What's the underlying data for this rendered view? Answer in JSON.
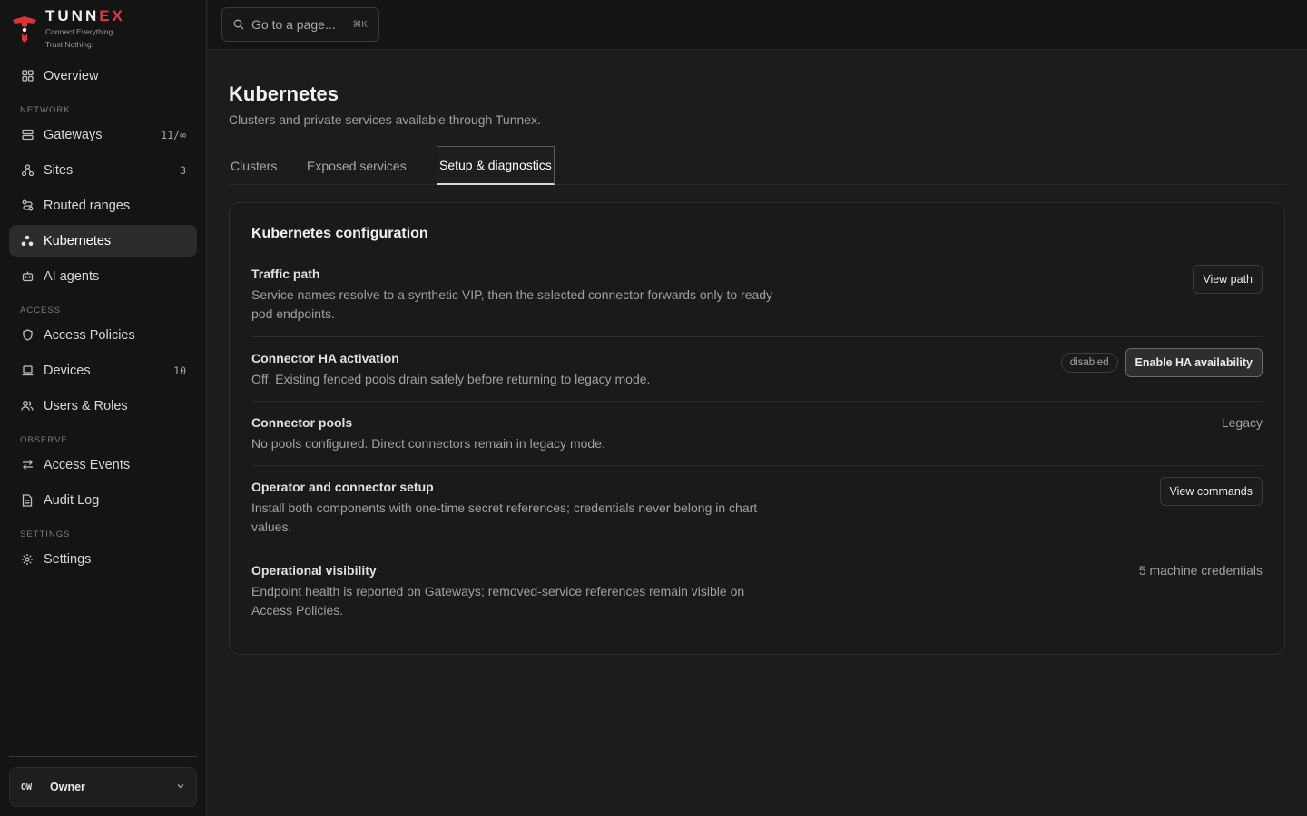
{
  "brand": {
    "wordmark_main": "TUNN",
    "wordmark_accent": "EX",
    "tagline_line1": "Connect Everything.",
    "tagline_line2": "Trust Nothing.",
    "accent_color": "#e0393e"
  },
  "sidebar": {
    "overview": {
      "label": "Overview",
      "icon": "grid-icon"
    },
    "sections": {
      "network": "NETWORK",
      "access": "ACCESS",
      "observe": "OBSERVE",
      "settings": "SETTINGS"
    },
    "items": {
      "gateways": {
        "label": "Gateways",
        "count": "11/∞",
        "icon": "server-icon"
      },
      "sites": {
        "label": "Sites",
        "count": "3",
        "icon": "sites-icon"
      },
      "routed_ranges": {
        "label": "Routed ranges",
        "icon": "route-icon"
      },
      "kubernetes": {
        "label": "Kubernetes",
        "icon": "kubernetes-icon",
        "active": true
      },
      "ai_agents": {
        "label": "AI agents",
        "icon": "bot-icon"
      },
      "access_policies": {
        "label": "Access Policies",
        "icon": "shield-icon"
      },
      "devices": {
        "label": "Devices",
        "count": "10",
        "icon": "laptop-icon"
      },
      "users_roles": {
        "label": "Users & Roles",
        "icon": "users-icon"
      },
      "access_events": {
        "label": "Access Events",
        "icon": "arrows-icon"
      },
      "audit_log": {
        "label": "Audit Log",
        "icon": "document-icon"
      },
      "settings": {
        "label": "Settings",
        "icon": "gear-icon"
      }
    },
    "owner": {
      "initials": "OW",
      "name": "Owner"
    }
  },
  "topbar": {
    "search_placeholder": "Go to a page...",
    "search_shortcut": "⌘K"
  },
  "page": {
    "title": "Kubernetes",
    "subtitle": "Clusters and private services available through Tunnex.",
    "tabs": [
      {
        "label": "Clusters",
        "active": false
      },
      {
        "label": "Exposed services",
        "active": false
      },
      {
        "label": "Setup & diagnostics",
        "active": true
      }
    ]
  },
  "card": {
    "title": "Kubernetes configuration",
    "rows": [
      {
        "title": "Traffic path",
        "description": "Service names resolve to a synthetic VIP, then the selected connector forwards only to ready pod endpoints.",
        "button": "View path"
      },
      {
        "title": "Connector HA activation",
        "description": "Off. Existing fenced pools drain safely before returning to legacy mode.",
        "badge": "disabled",
        "button": "Enable HA availability"
      },
      {
        "title": "Connector pools",
        "description": "No pools configured. Direct connectors remain in legacy mode.",
        "status": "Legacy"
      },
      {
        "title": "Operator and connector setup",
        "description": "Install both components with one-time secret references; credentials never belong in chart values.",
        "button": "View commands"
      },
      {
        "title": "Operational visibility",
        "description": "Endpoint health is reported on Gateways; removed-service references remain visible on Access Policies.",
        "status": "5 machine credentials"
      }
    ]
  }
}
